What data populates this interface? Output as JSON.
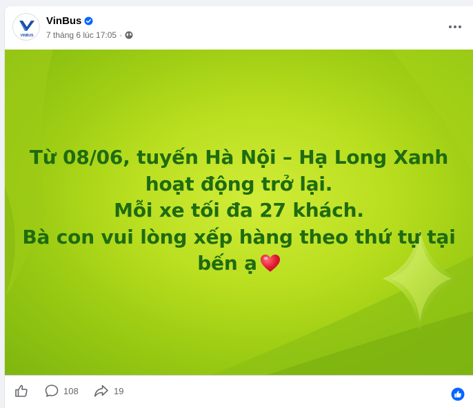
{
  "post": {
    "author": "VinBus",
    "avatar_text": "VINBUS",
    "timestamp": "7 tháng 6 lúc 17:05",
    "separator": "·",
    "privacy_icon": "globe-icon",
    "verified_icon": "verified-badge-icon",
    "more_icon": "more-options-icon"
  },
  "image_text": {
    "lines": [
      "Từ 08/06, tuyến Hà Nội – Hạ Long Xanh",
      "hoạt động trở lại.",
      "Mỗi xe tối đa 27 khách.",
      "Bà con vui lòng xếp hàng theo thứ tự tại",
      "bến ạ"
    ],
    "emoji": "heart-emoji",
    "text_color": "#1f6b10",
    "background_color": "#b6dc1c"
  },
  "actions": {
    "like_icon": "like-icon",
    "comment_icon": "comment-icon",
    "comment_count": "108",
    "share_icon": "share-icon",
    "share_count": "19",
    "reaction_icon": "like-reaction-icon"
  },
  "colors": {
    "accent": "#0866ff",
    "secondary_text": "#65676b"
  }
}
